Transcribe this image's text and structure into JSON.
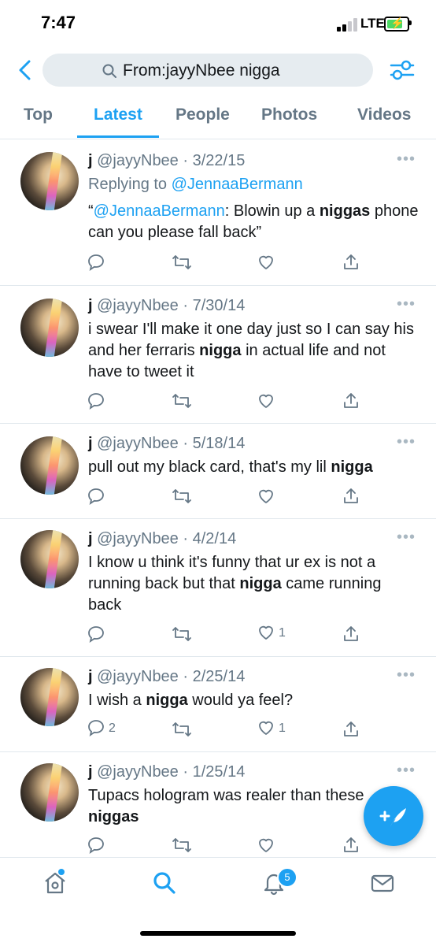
{
  "status": {
    "time": "7:47",
    "network": "LTE"
  },
  "search": {
    "query": "From:jayyNbee nigga"
  },
  "tabs": [
    {
      "label": "Top"
    },
    {
      "label": "Latest"
    },
    {
      "label": "People"
    },
    {
      "label": "Photos"
    },
    {
      "label": "Videos"
    }
  ],
  "tweets": [
    {
      "name": "j",
      "handle": "@jayyNbee",
      "date": "· 3/22/15",
      "replying_prefix": "Replying to ",
      "replying_handle": "@JennaaBermann",
      "text_open": "“",
      "text_mention": "@JennaaBermann",
      "text_a": ": Blowin up a ",
      "text_bold": "niggas",
      "text_b": " phone can you please fall back”"
    },
    {
      "name": "j",
      "handle": "@jayyNbee",
      "date": "· 7/30/14",
      "text_a": "i swear I'll make it one day just so I can say his and her ferraris ",
      "text_bold": "nigga",
      "text_b": " in actual life and not have to tweet it"
    },
    {
      "name": "j",
      "handle": "@jayyNbee",
      "date": "· 5/18/14",
      "text_a": "pull out my black card, that's my lil ",
      "text_bold": "nigga",
      "text_b": ""
    },
    {
      "name": "j",
      "handle": "@jayyNbee",
      "date": "· 4/2/14",
      "text_a": "I know u think it's funny that ur ex is not a running back but that ",
      "text_bold": "nigga",
      "text_b": " came running back",
      "like_count": "1"
    },
    {
      "name": "j",
      "handle": "@jayyNbee",
      "date": "· 2/25/14",
      "text_a": "I wish a ",
      "text_bold": "nigga",
      "text_b": " would ya feel?",
      "reply_count": "2",
      "like_count": "1"
    },
    {
      "name": "j",
      "handle": "@jayyNbee",
      "date": "· 1/25/14",
      "text_a": "Tupacs hologram was realer than these ",
      "text_bold": "niggas",
      "text_b": ""
    }
  ],
  "tabbar": {
    "notifications_badge": "5"
  },
  "colors": {
    "accent": "#1da1f2",
    "text": "#14171a",
    "secondary": "#657786",
    "divider": "#e1e8ed"
  }
}
